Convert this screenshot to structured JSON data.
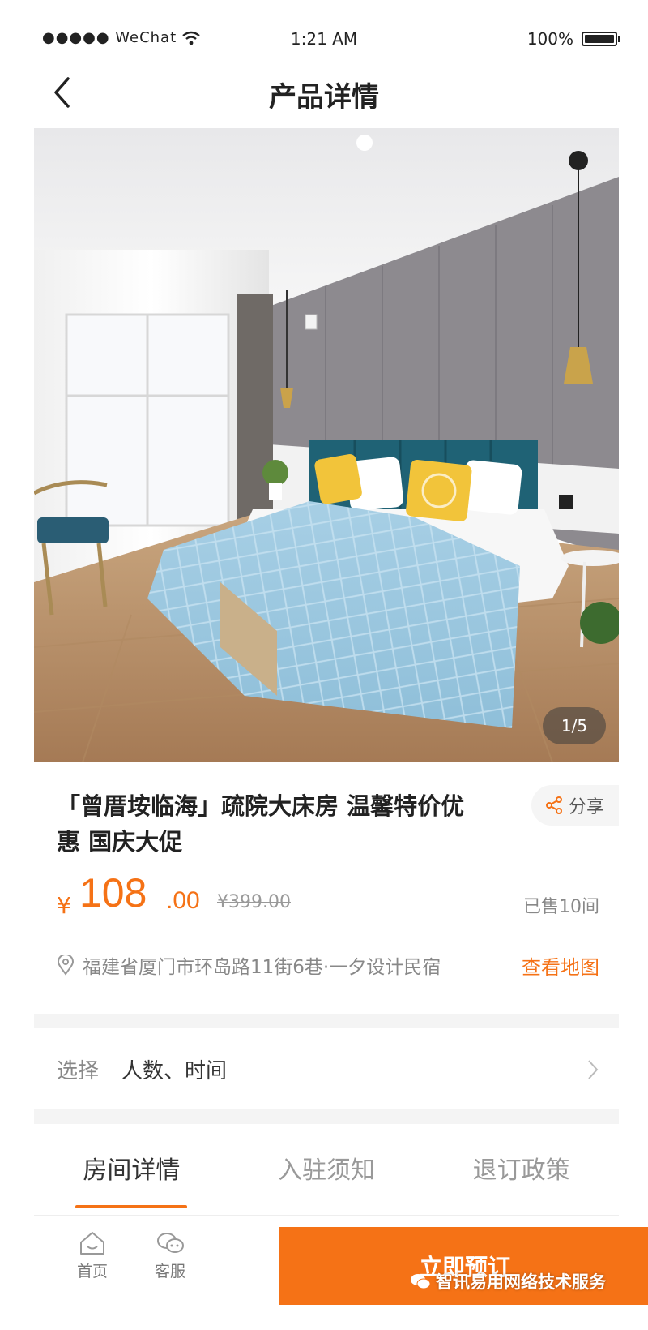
{
  "status_bar": {
    "signal": "●●●●● WeChat",
    "time": "1:21 AM",
    "battery": "100%"
  },
  "nav": {
    "title": "产品详情"
  },
  "gallery": {
    "counter": "1/5",
    "current": 1,
    "total": 5
  },
  "product": {
    "title": "「曾厝垵临海」疏院大床房 温馨特价优惠 国庆大促",
    "share_label": "分享",
    "price_currency": "¥",
    "price_integer": "108",
    "price_decimal": ".00",
    "original_price": "¥399.00",
    "sold": "已售10间",
    "address": "福建省厦门市环岛路11街6巷·一夕设计民宿",
    "map_link": "查看地图"
  },
  "selection": {
    "label": "选择",
    "value": "人数、时间"
  },
  "tabs": [
    {
      "label": "房间详情",
      "active": true
    },
    {
      "label": "入驻须知",
      "active": false
    },
    {
      "label": "退订政策",
      "active": false
    }
  ],
  "bottom": {
    "home_label": "首页",
    "service_label": "客服",
    "book_label": "立即预订",
    "watermark": "智讯易用网络技术服务"
  },
  "colors": {
    "accent": "#f57216",
    "text": "#222222",
    "muted": "#888888",
    "divider": "#f4f4f4"
  }
}
